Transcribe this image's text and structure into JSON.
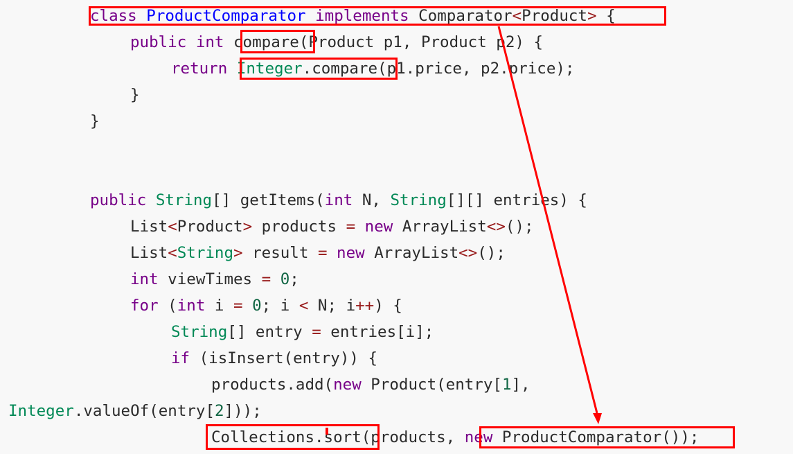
{
  "code": {
    "line_class": [
      {
        "t": "class",
        "c": "tok-kw"
      },
      {
        "t": " ",
        "c": "tok-id"
      },
      {
        "t": "ProductComparator",
        "c": "tok-def"
      },
      {
        "t": " ",
        "c": "tok-id"
      },
      {
        "t": "implements",
        "c": "tok-kw"
      },
      {
        "t": " Comparator",
        "c": "tok-id"
      },
      {
        "t": "<",
        "c": "tok-op"
      },
      {
        "t": "Product",
        "c": "tok-id"
      },
      {
        "t": ">",
        "c": "tok-op"
      },
      {
        "t": " {",
        "c": "tok-id"
      }
    ],
    "line_compare_sig": [
      {
        "t": "public",
        "c": "tok-kw"
      },
      {
        "t": " ",
        "c": "tok-id"
      },
      {
        "t": "int",
        "c": "tok-kw"
      },
      {
        "t": " compare(Product p1, Product p2) {",
        "c": "tok-id"
      }
    ],
    "line_return": [
      {
        "t": "return",
        "c": "tok-kw"
      },
      {
        "t": " ",
        "c": "tok-id"
      },
      {
        "t": "Integer",
        "c": "tok-type"
      },
      {
        "t": ".compare(p1.price, p2.price);",
        "c": "tok-id"
      }
    ],
    "line_close_method": [
      {
        "t": "}",
        "c": "tok-id"
      }
    ],
    "line_close_class": [
      {
        "t": "}",
        "c": "tok-id"
      }
    ],
    "line_getitems": [
      {
        "t": "public",
        "c": "tok-kw"
      },
      {
        "t": " ",
        "c": "tok-id"
      },
      {
        "t": "String",
        "c": "tok-type"
      },
      {
        "t": "[] getItems(",
        "c": "tok-id"
      },
      {
        "t": "int",
        "c": "tok-kw"
      },
      {
        "t": " N, ",
        "c": "tok-id"
      },
      {
        "t": "String",
        "c": "tok-type"
      },
      {
        "t": "[][] entries) {",
        "c": "tok-id"
      }
    ],
    "line_products_decl": [
      {
        "t": "List",
        "c": "tok-id"
      },
      {
        "t": "<",
        "c": "tok-op"
      },
      {
        "t": "Product",
        "c": "tok-id"
      },
      {
        "t": ">",
        "c": "tok-op"
      },
      {
        "t": " products ",
        "c": "tok-id"
      },
      {
        "t": "=",
        "c": "tok-op"
      },
      {
        "t": " ",
        "c": "tok-id"
      },
      {
        "t": "new",
        "c": "tok-kw"
      },
      {
        "t": " ArrayList",
        "c": "tok-id"
      },
      {
        "t": "<>",
        "c": "tok-op"
      },
      {
        "t": "();",
        "c": "tok-id"
      }
    ],
    "line_result_decl": [
      {
        "t": "List",
        "c": "tok-id"
      },
      {
        "t": "<",
        "c": "tok-op"
      },
      {
        "t": "String",
        "c": "tok-type"
      },
      {
        "t": ">",
        "c": "tok-op"
      },
      {
        "t": " result ",
        "c": "tok-id"
      },
      {
        "t": "=",
        "c": "tok-op"
      },
      {
        "t": " ",
        "c": "tok-id"
      },
      {
        "t": "new",
        "c": "tok-kw"
      },
      {
        "t": " ArrayList",
        "c": "tok-id"
      },
      {
        "t": "<>",
        "c": "tok-op"
      },
      {
        "t": "();",
        "c": "tok-id"
      }
    ],
    "line_viewtimes": [
      {
        "t": "int",
        "c": "tok-kw"
      },
      {
        "t": " viewTimes ",
        "c": "tok-id"
      },
      {
        "t": "=",
        "c": "tok-op"
      },
      {
        "t": " ",
        "c": "tok-id"
      },
      {
        "t": "0",
        "c": "tok-num"
      },
      {
        "t": ";",
        "c": "tok-id"
      }
    ],
    "line_for": [
      {
        "t": "for",
        "c": "tok-kw"
      },
      {
        "t": " (",
        "c": "tok-id"
      },
      {
        "t": "int",
        "c": "tok-kw"
      },
      {
        "t": " i ",
        "c": "tok-id"
      },
      {
        "t": "=",
        "c": "tok-op"
      },
      {
        "t": " ",
        "c": "tok-id"
      },
      {
        "t": "0",
        "c": "tok-num"
      },
      {
        "t": "; i ",
        "c": "tok-id"
      },
      {
        "t": "<",
        "c": "tok-op"
      },
      {
        "t": " N; i",
        "c": "tok-id"
      },
      {
        "t": "++",
        "c": "tok-op"
      },
      {
        "t": ") {",
        "c": "tok-id"
      }
    ],
    "line_entry": [
      {
        "t": "String",
        "c": "tok-type"
      },
      {
        "t": "[] entry ",
        "c": "tok-id"
      },
      {
        "t": "=",
        "c": "tok-op"
      },
      {
        "t": " entries[i];",
        "c": "tok-id"
      }
    ],
    "line_if": [
      {
        "t": "if",
        "c": "tok-kw"
      },
      {
        "t": " (isInsert(entry)) {",
        "c": "tok-id"
      }
    ],
    "line_add": [
      {
        "t": "products.add(",
        "c": "tok-id"
      },
      {
        "t": "new",
        "c": "tok-kw"
      },
      {
        "t": " Product(entry[",
        "c": "tok-id"
      },
      {
        "t": "1",
        "c": "tok-num"
      },
      {
        "t": "],",
        "c": "tok-id"
      }
    ],
    "line_add_cont": [
      {
        "t": "Integer",
        "c": "tok-type"
      },
      {
        "t": ".valueOf(entry[",
        "c": "tok-id"
      },
      {
        "t": "2",
        "c": "tok-num"
      },
      {
        "t": "]));",
        "c": "tok-id"
      }
    ],
    "line_sort": [
      {
        "t": "Collections.sort(products, ",
        "c": "tok-id"
      },
      {
        "t": "new",
        "c": "tok-kw"
      },
      {
        "t": " ProductComparator());",
        "c": "tok-id"
      }
    ]
  },
  "annotation": {
    "color": "#ff0000"
  }
}
